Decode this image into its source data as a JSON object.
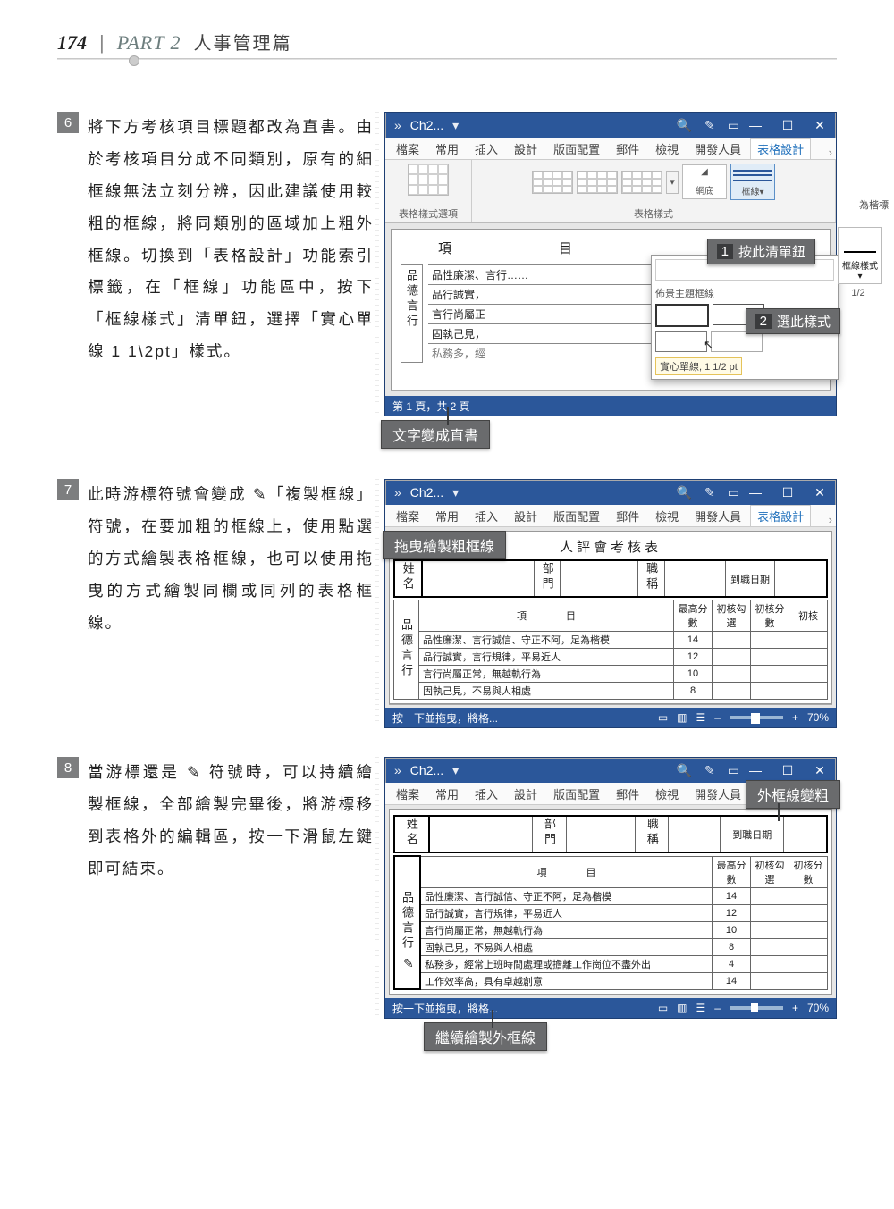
{
  "page": {
    "number": "174",
    "part": "PART 2",
    "section": "人事管理篇"
  },
  "steps": {
    "6": {
      "num": "6",
      "text": "將下方考核項目標題都改為直書。由於考核項目分成不同類別，原有的細框線無法立刻分辨，因此建議使用較粗的框線，將同類別的區域加上粗外框線。切換到「表格設計」功能索引標籤，在「框線」功能區中，按下「框線樣式」清單鈕，選擇「實心單線 1 1\\2pt」樣式。"
    },
    "7": {
      "num": "7",
      "text": "此時游標符號會變成 ✎「複製框線」符號，在要加粗的框線上，使用點選的方式繪製表格框線，也可以使用拖曳的方式繪製同欄或同列的表格框線。"
    },
    "8": {
      "num": "8",
      "text": "當游標還是 ✎ 符號時，可以持續繪製框線，全部繪製完畢後，將游標移到表格外的編輯區，按一下滑鼠左鍵即可結束。"
    }
  },
  "word": {
    "title": "Ch2...",
    "tabs": [
      "檔案",
      "常用",
      "插入",
      "設計",
      "版面配置",
      "郵件",
      "檢視",
      "開發人員",
      "表格設計"
    ],
    "ribbon": {
      "grp1": "表格樣式選項",
      "grp2": "表格樣式",
      "btn_grid": "網底",
      "btn_border": "框線",
      "btn_border_style": "框線樣式"
    },
    "status": {
      "page": "第 1 頁，共 2 頁",
      "drag": "按一下並拖曳，將格...",
      "zoom": "70%"
    }
  },
  "shot6": {
    "header_item": "項",
    "header_moku": "目",
    "vert_label": "品德言行",
    "rows": [
      "品性廉潔、言行……",
      "品行誠實，",
      "言行尚屬正",
      "固執己見，",
      "私務多，經"
    ],
    "popup_header": "佈景主題框線",
    "tooltip": "實心單線, 1 1/2 pt",
    "callout1": "按此清單鈕",
    "callout2": "選此樣式",
    "callout3": "文字變成直書",
    "extra": "為楷標",
    "fraction": "1/2"
  },
  "shot7": {
    "callout1": "拖曳繪製粗框線",
    "doc_title": "人評會考核表",
    "cols": {
      "name": "姓名",
      "dept": "部門",
      "title": "職稱",
      "date": "到職日期"
    },
    "score_head": {
      "item": "項",
      "moku": "目",
      "max": "最高分數",
      "init_sel": "初核勾選",
      "init": "初核分數",
      "init2": "初核"
    },
    "rows": [
      {
        "t": "品性廉潔、言行誠信、守正不阿，足為楷模",
        "s": "14"
      },
      {
        "t": "品行誠實，言行規律，平易近人",
        "s": "12"
      },
      {
        "t": "言行尚屬正常，無越軌行為",
        "s": "10"
      },
      {
        "t": "固執己見，不易與人相處",
        "s": "8"
      }
    ],
    "vert_label": "品德言行"
  },
  "shot8": {
    "callout_top": "外框線變粗",
    "callout_bottom": "繼續繪製外框線",
    "cols": {
      "name": "姓名",
      "dept": "部門",
      "title": "職稱",
      "date": "到職日期"
    },
    "score_head": {
      "item": "項",
      "moku": "目",
      "max": "最高分數",
      "init_sel": "初核勾選",
      "init": "初核分數"
    },
    "rows": [
      {
        "t": "品性廉潔、言行誠信、守正不阿，足為楷模",
        "s": "14"
      },
      {
        "t": "品行誠實，言行規律，平易近人",
        "s": "12"
      },
      {
        "t": "言行尚屬正常，無越軌行為",
        "s": "10"
      },
      {
        "t": "固執己見，不易與人相處",
        "s": "8"
      },
      {
        "t": "私務多，經常上班時間處理或擔離工作崗位不盡外出",
        "s": "4"
      },
      {
        "t": "工作效率高，具有卓越創意",
        "s": "14"
      }
    ],
    "vert_label": "品德言行"
  }
}
